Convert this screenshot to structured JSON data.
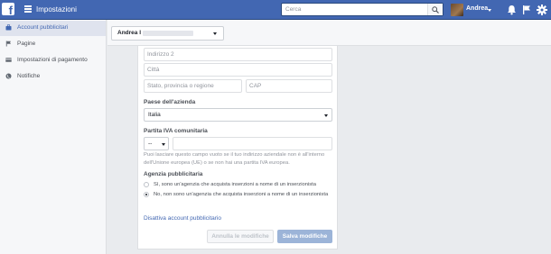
{
  "header": {
    "logo": "f",
    "title": "Impostazioni",
    "search_placeholder": "Cerca",
    "user_name": "Andrea",
    "icons": [
      "facebook-logo",
      "menu-icon",
      "search-icon",
      "avatar",
      "bell-icon",
      "flag-icon",
      "gear-icon"
    ]
  },
  "sidebar": {
    "items": [
      {
        "label": "Account pubblicitari",
        "icon": "briefcase-icon",
        "active": true
      },
      {
        "label": "Pagine",
        "icon": "flag-icon",
        "active": false
      },
      {
        "label": "Impostazioni di pagamento",
        "icon": "card-icon",
        "active": false
      },
      {
        "label": "Notifiche",
        "icon": "globe-icon",
        "active": false
      }
    ]
  },
  "account_selector": {
    "name": "Andrea I"
  },
  "form": {
    "address2_placeholder": "Indirizzo 2",
    "city_placeholder": "Città",
    "state_placeholder": "Stato, provincia o regione",
    "zip_placeholder": "CAP",
    "country_label": "Paese dell'azienda",
    "country_value": "Italia",
    "vat_label": "Partita IVA comunitaria",
    "vat_prefix": "--",
    "vat_help": "Puoi lasciare questo campo vuoto se il tuo indirizzo aziendale non è all'interno dell'Unione europea (UE) o se non hai una partita IVA europea.",
    "agency_label": "Agenzia pubblicitaria",
    "agency_option_yes": "Sì, sono un'agenzia che acquista inserzioni a nome di un inserzionista",
    "agency_option_no": "No, non sono un'agenzia che acquista inserzioni a nome di un inserzionista",
    "agency_selected": "no",
    "deactivate_link": "Disattiva account pubblicitario",
    "cancel_button": "Annulla le modifiche",
    "save_button": "Salva modifiche"
  },
  "colors": {
    "brand_blue": "#4267b2",
    "disabled_blue": "#9cb4d8"
  }
}
